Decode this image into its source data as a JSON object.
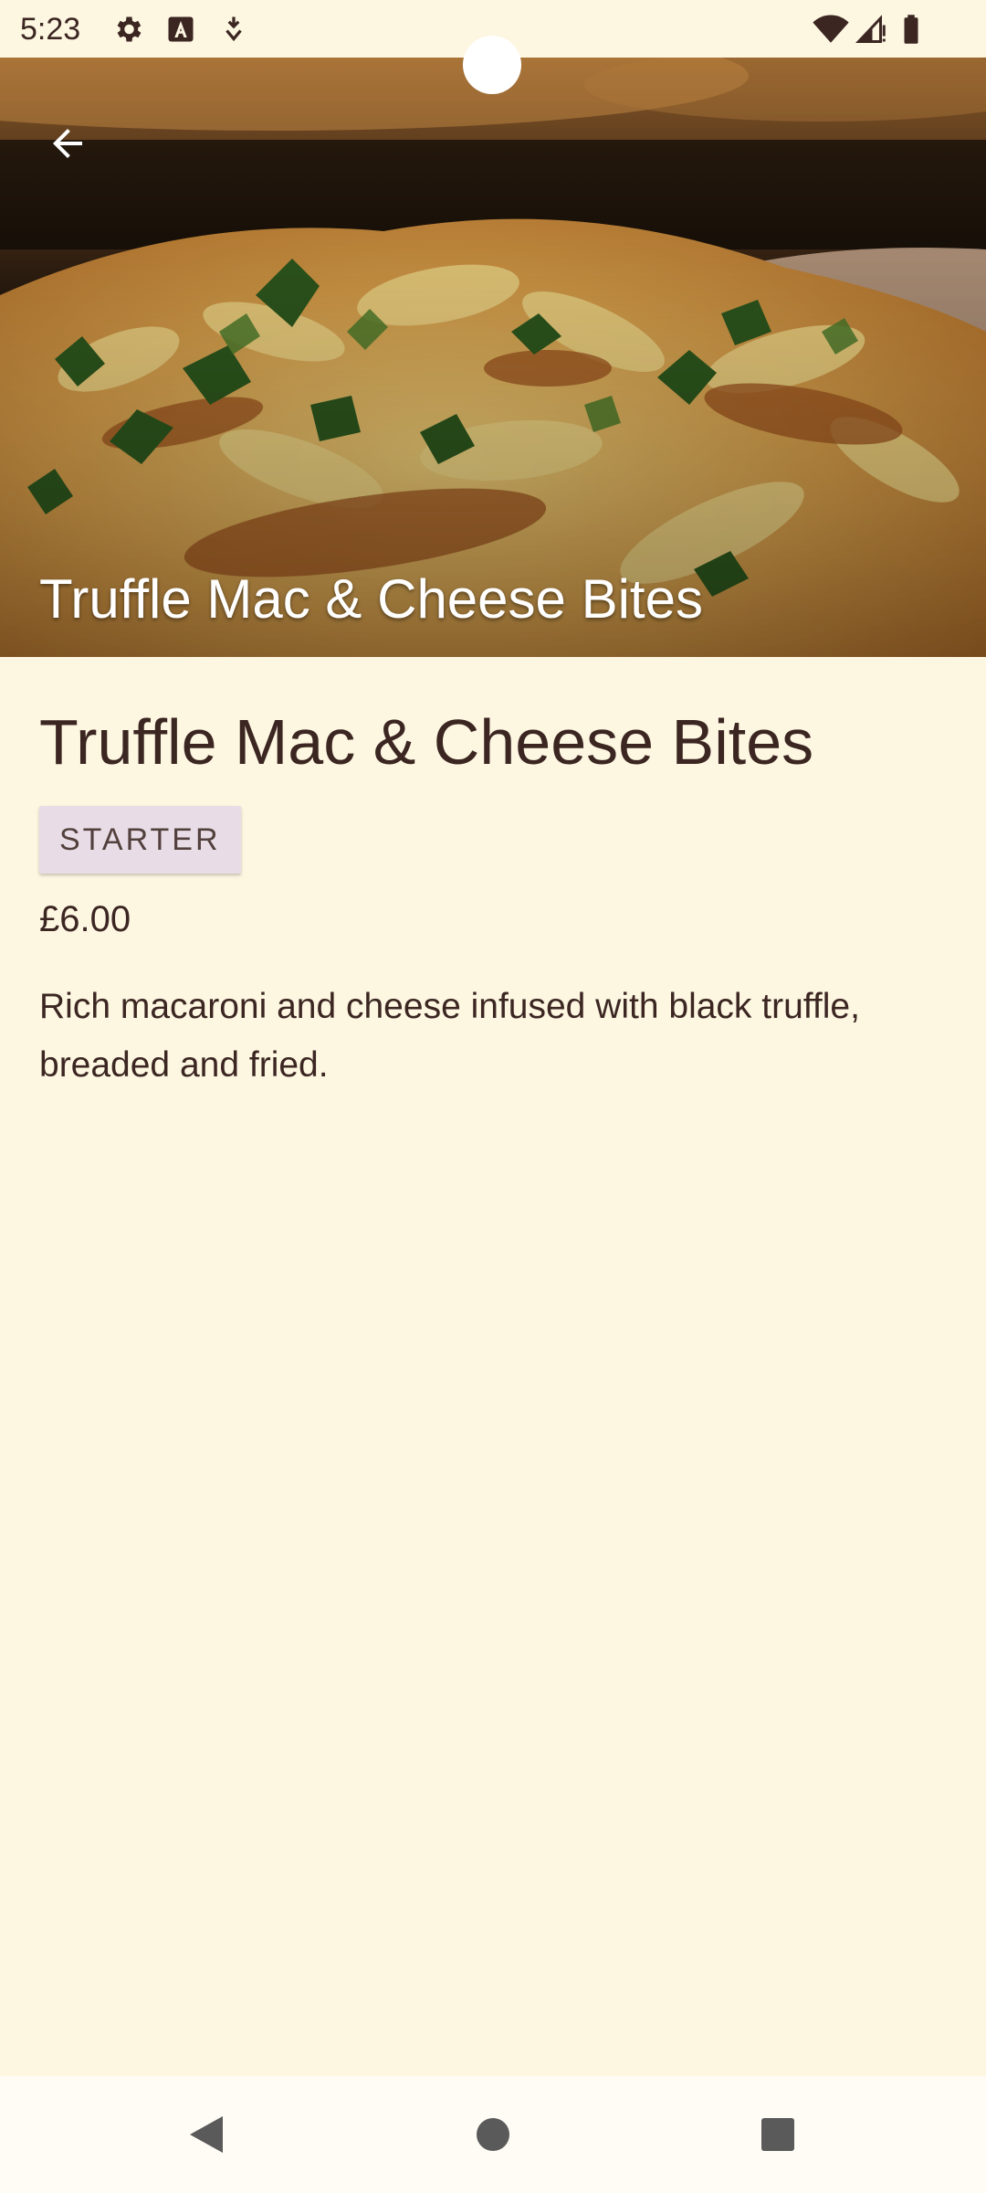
{
  "status_bar": {
    "time": "5:23",
    "icons_left": [
      "settings-icon",
      "text-a-icon",
      "download-shield-icon"
    ],
    "icons_right": [
      "wifi-icon",
      "cellular-signal-icon",
      "battery-icon"
    ]
  },
  "hero": {
    "overlay_title": "Truffle Mac & Cheese Bites",
    "back_icon": "arrow-back-icon"
  },
  "dish": {
    "title": "Truffle Mac & Cheese Bites",
    "category": "STARTER",
    "price": "£6.00",
    "description": "Rich macaroni and cheese infused with black truffle, breaded and fried."
  },
  "nav_bar": {
    "buttons": [
      "back-triangle-icon",
      "home-circle-icon",
      "recents-square-icon"
    ]
  },
  "colors": {
    "background": "#FDF6E1",
    "text": "#3B2622",
    "badge_background": "#E8DDE7",
    "nav_background": "#FFFBF5"
  }
}
